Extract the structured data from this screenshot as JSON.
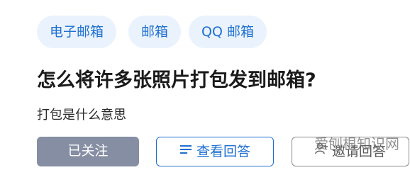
{
  "tags": [
    {
      "label": "电子邮箱"
    },
    {
      "label": "邮箱"
    },
    {
      "label": "QQ 邮箱"
    }
  ],
  "question": {
    "title": "怎么将许多张照片打包发到邮箱?",
    "subtitle": "打包是什么意思"
  },
  "actions": {
    "follow_label": "已关注",
    "view_answers_label": "查看回答",
    "invite_label": "邀请回答"
  },
  "watermark": "爱刨根知识网",
  "colors": {
    "accent": "#1e6fd1",
    "tag_bg": "#eaf3fd",
    "followed_bg": "#858ea3"
  }
}
